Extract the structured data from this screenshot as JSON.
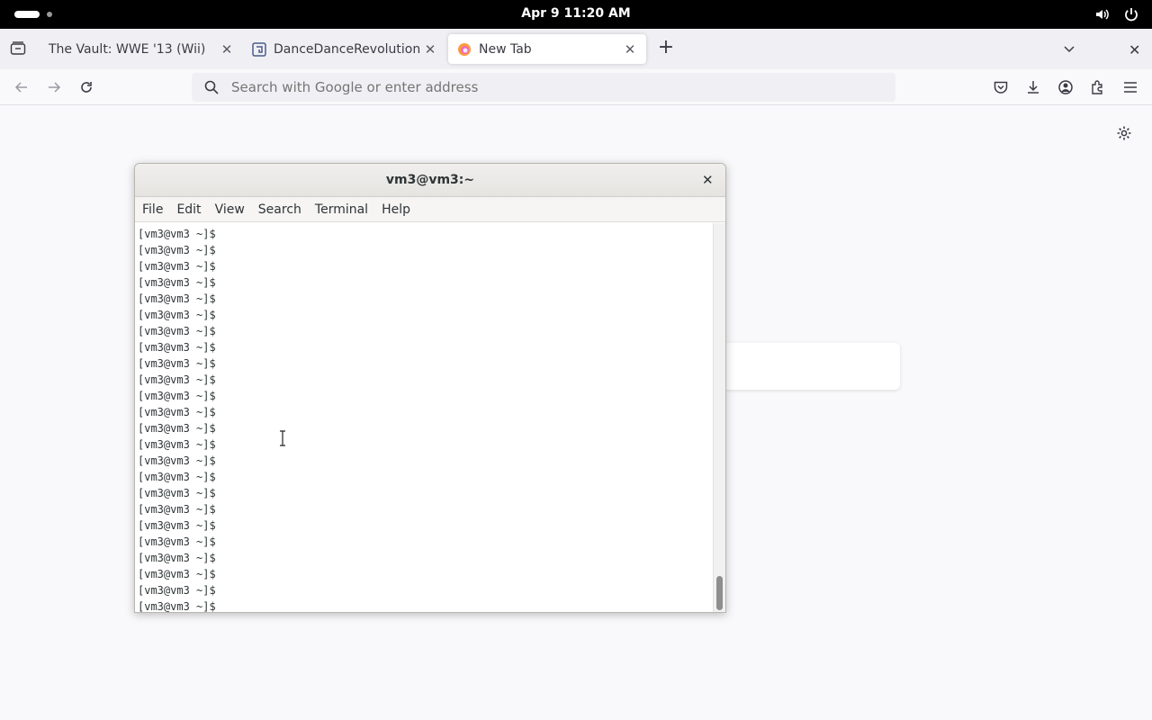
{
  "topbar": {
    "clock": "Apr 9  11:20 AM",
    "icons": [
      "volume-icon",
      "power-icon"
    ]
  },
  "browser": {
    "tabs": [
      {
        "label": "The Vault: WWE '13 (Wii)",
        "active": false
      },
      {
        "label": "DanceDanceRevolution II",
        "active": false
      },
      {
        "label": "New Tab",
        "active": true
      }
    ],
    "new_tab_label": "+",
    "close_glyph": "✕",
    "url_placeholder": "Search with Google or enter address",
    "accent": "#0061e0"
  },
  "terminal": {
    "title": "vm3@vm3:~",
    "close_glyph": "✕",
    "menu": [
      "File",
      "Edit",
      "View",
      "Search",
      "Terminal",
      "Help"
    ],
    "lines": [
      "[vm3@vm3 ~]$",
      "[vm3@vm3 ~]$",
      "[vm3@vm3 ~]$",
      "[vm3@vm3 ~]$",
      "[vm3@vm3 ~]$",
      "[vm3@vm3 ~]$",
      "[vm3@vm3 ~]$",
      "[vm3@vm3 ~]$",
      "[vm3@vm3 ~]$",
      "[vm3@vm3 ~]$",
      "[vm3@vm3 ~]$",
      "[vm3@vm3 ~]$",
      "[vm3@vm3 ~]$",
      "[vm3@vm3 ~]$",
      "[vm3@vm3 ~]$",
      "[vm3@vm3 ~]$",
      "[vm3@vm3 ~]$",
      "[vm3@vm3 ~]$",
      "[vm3@vm3 ~]$",
      "[vm3@vm3 ~]$",
      "[vm3@vm3 ~]$",
      "[vm3@vm3 ~]$",
      "[vm3@vm3 ~]$",
      "[vm3@vm3 ~]$"
    ]
  }
}
